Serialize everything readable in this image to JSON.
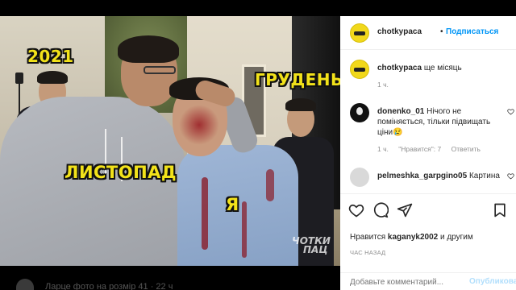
{
  "post": {
    "author": "chotkypaca",
    "follow_label": "Подписаться",
    "separator": "•",
    "caption": "ще місяць",
    "caption_time": "1 ч."
  },
  "image": {
    "overlay_labels": {
      "year": "2021",
      "december": "ГРУДЕНЬ",
      "november": "ЛИСТОПАД",
      "me": "Я"
    },
    "watermark_line1": "ЧОТКИ",
    "watermark_line2": "ПАЦ"
  },
  "comments": [
    {
      "author": "donenko_01",
      "text": "Нічого не поміняється, тільки підвищать ціни😢",
      "time": "1 ч.",
      "likes_label": "\"Нравится\": 7",
      "reply_label": "Ответить"
    },
    {
      "author": "pelmeshka_garpgino05",
      "text": "Картина"
    }
  ],
  "actions": {
    "likes_prefix": "Нравится",
    "likes_user": "kaganyk2002",
    "likes_suffix": "и другим",
    "time_ago": "ЧАС НАЗАД"
  },
  "add_comment": {
    "placeholder": "Добавьте комментарий...",
    "publish_label": "Опубликовать"
  },
  "background_feed": {
    "text": "Ларце фото на розмір 41 · 22 ч"
  },
  "colors": {
    "accent": "#0095f6",
    "meme_text": "#f2e21a",
    "muted": "#8e8e8e",
    "text": "#262626"
  }
}
